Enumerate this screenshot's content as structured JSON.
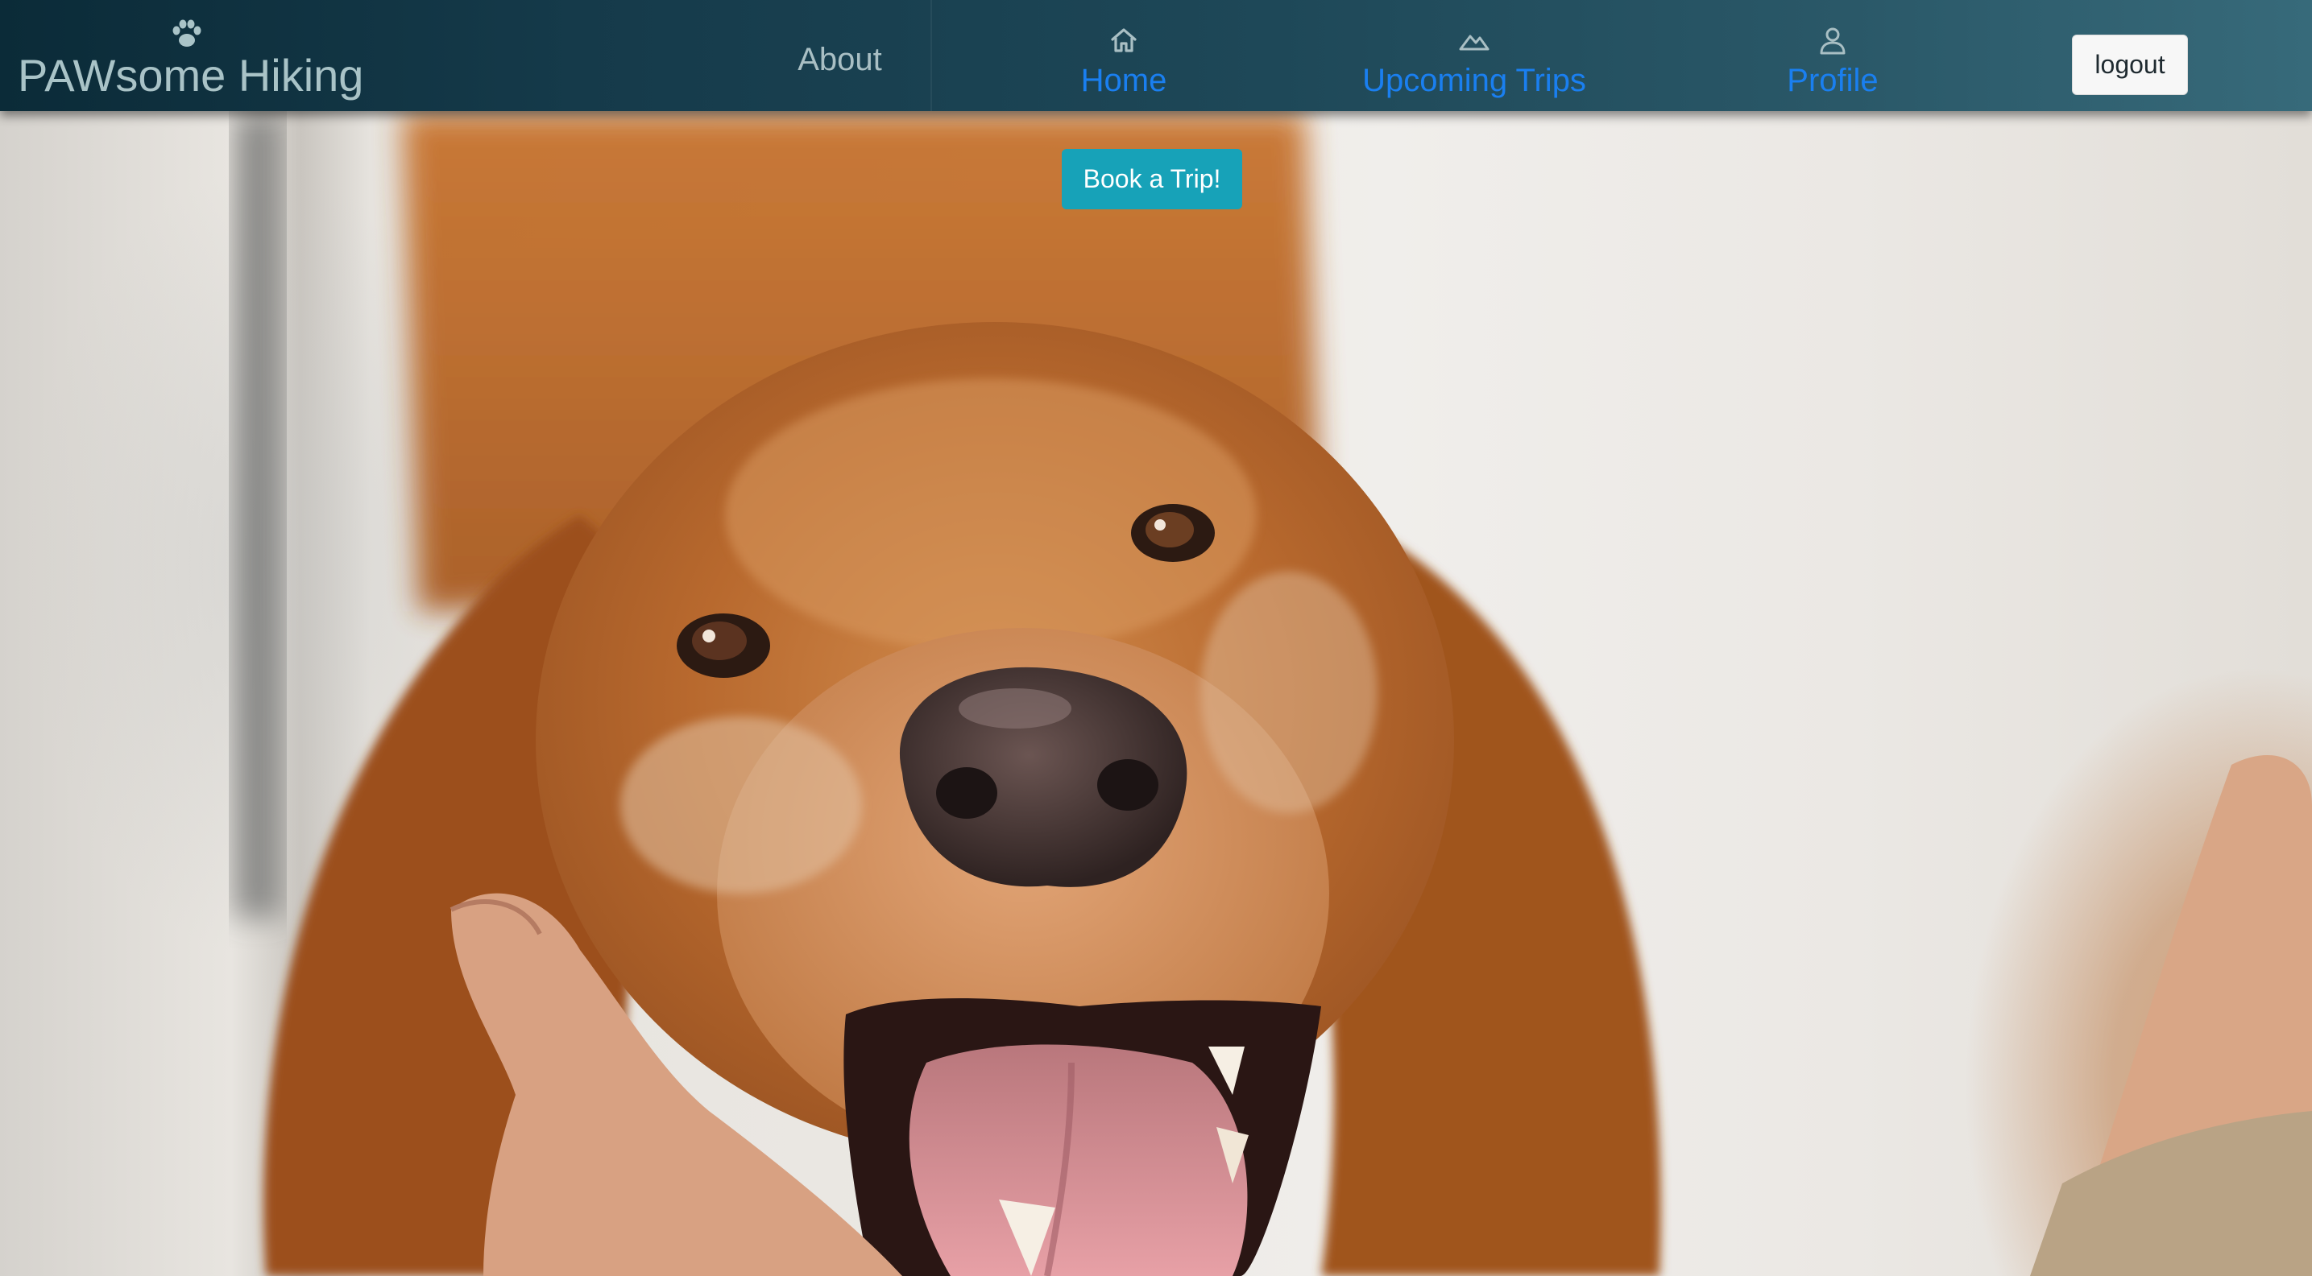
{
  "brand": {
    "name": "PAWsome Hiking",
    "icon": "paw-icon"
  },
  "nav": {
    "about": {
      "label": "About"
    },
    "home": {
      "label": "Home",
      "icon": "home-icon"
    },
    "trips": {
      "label": "Upcoming Trips",
      "icon": "mountain-icon"
    },
    "profile": {
      "label": "Profile",
      "icon": "person-icon"
    }
  },
  "auth": {
    "logout_label": "logout"
  },
  "hero": {
    "cta_label": "Book a Trip!",
    "image": "golden-retriever-photo"
  },
  "colors": {
    "nav_link": "#1a7ff0",
    "cta": "#17a2b8",
    "navbar_start": "#0b2b38",
    "navbar_end": "#376a7a"
  }
}
